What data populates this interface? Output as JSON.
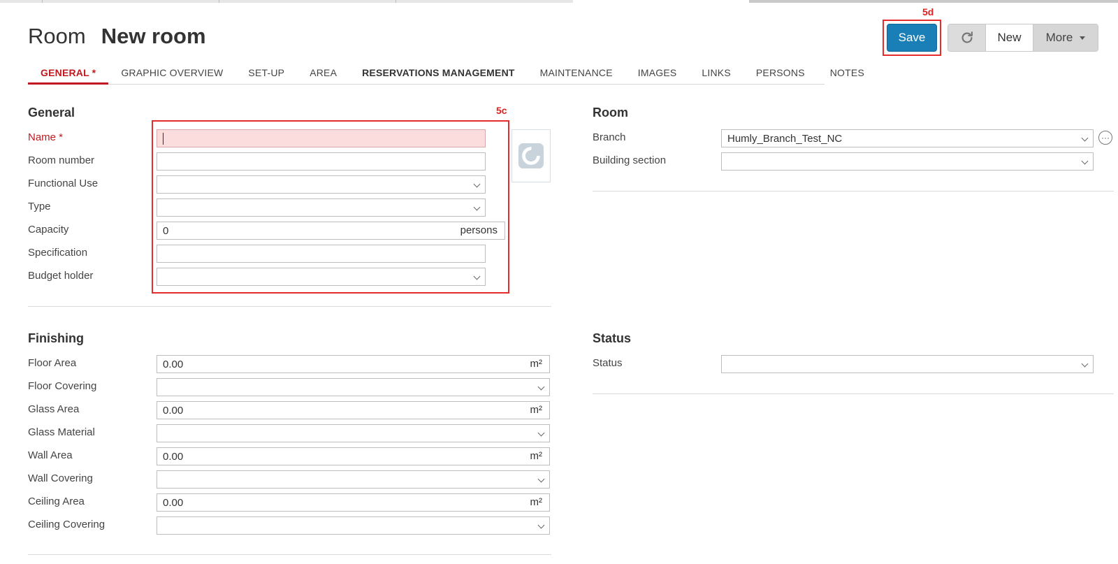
{
  "header": {
    "entity_label": "Room",
    "record_title": "New room"
  },
  "annotations": {
    "save_marker": "5d",
    "general_fields_marker": "5c"
  },
  "toolbar": {
    "save_label": "Save",
    "refresh_icon": "refresh-icon",
    "new_label": "New",
    "more_label": "More"
  },
  "tabs": [
    {
      "label": "GENERAL *",
      "active": true
    },
    {
      "label": "GRAPHIC OVERVIEW"
    },
    {
      "label": "SET-UP"
    },
    {
      "label": "AREA"
    },
    {
      "label": "RESERVATIONS MANAGEMENT"
    },
    {
      "label": "MAINTENANCE"
    },
    {
      "label": "IMAGES"
    },
    {
      "label": "LINKS"
    },
    {
      "label": "PERSONS"
    },
    {
      "label": "NOTES"
    }
  ],
  "general": {
    "title": "General",
    "name_label": "Name *",
    "name_value": "",
    "room_number_label": "Room number",
    "room_number_value": "",
    "functional_use_label": "Functional Use",
    "functional_use_value": "",
    "type_label": "Type",
    "type_value": "",
    "capacity_label": "Capacity",
    "capacity_value": "0",
    "capacity_unit": "persons",
    "specification_label": "Specification",
    "specification_value": "",
    "budget_holder_label": "Budget holder",
    "budget_holder_value": ""
  },
  "room": {
    "title": "Room",
    "branch_label": "Branch",
    "branch_value": "Humly_Branch_Test_NC",
    "building_section_label": "Building section",
    "building_section_value": ""
  },
  "finishing": {
    "title": "Finishing",
    "floor_area_label": "Floor Area",
    "floor_area_value": "0.00",
    "floor_covering_label": "Floor Covering",
    "floor_covering_value": "",
    "glass_area_label": "Glass Area",
    "glass_area_value": "0.00",
    "glass_material_label": "Glass Material",
    "glass_material_value": "",
    "wall_area_label": "Wall Area",
    "wall_area_value": "0.00",
    "wall_covering_label": "Wall Covering",
    "wall_covering_value": "",
    "ceiling_area_label": "Ceiling Area",
    "ceiling_area_value": "0.00",
    "ceiling_covering_label": "Ceiling Covering",
    "ceiling_covering_value": "",
    "area_unit": "m²"
  },
  "status": {
    "title": "Status",
    "status_label": "Status",
    "status_value": ""
  },
  "colors": {
    "accent_red": "#c0191f",
    "save_blue": "#1a7fb6",
    "error_fill": "#fbdddd",
    "annotation_red": "#e52d2d"
  }
}
